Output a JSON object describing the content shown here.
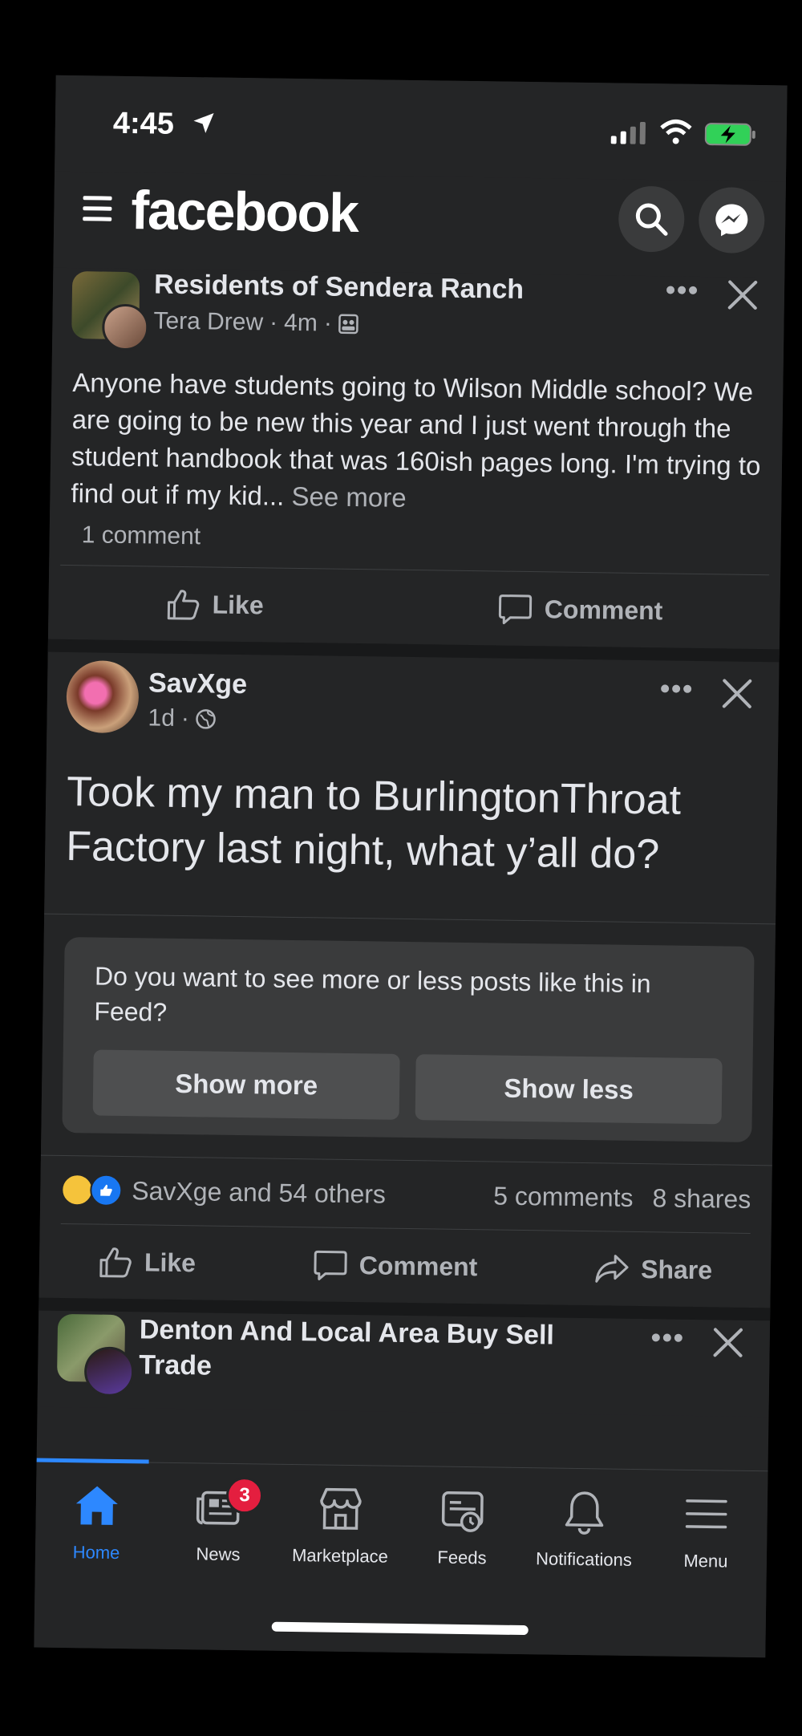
{
  "status": {
    "time": "4:45"
  },
  "app": {
    "logo": "facebook"
  },
  "posts": [
    {
      "group": "Residents of Sendera Ranch",
      "author": "Tera Drew",
      "time": "4m",
      "text": "Anyone have students going to Wilson Middle school? We are going to be new this year and I just went through the student handbook that was 160ish pages long. I'm trying to find out if my kid...",
      "see_more": "See more",
      "comment_count": "1 comment",
      "actions": {
        "like": "Like",
        "comment": "Comment"
      }
    },
    {
      "author": "SavXge",
      "time": "1d",
      "text": "Took my man to BurlingtonThroat Factory last night, what y’all do?",
      "feedback": {
        "question": "Do you want to see more or less posts like this in Feed?",
        "show_more": "Show more",
        "show_less": "Show less"
      },
      "reactions_text": "SavXge and 54 others",
      "comments": "5 comments",
      "shares": "8 shares",
      "actions": {
        "like": "Like",
        "comment": "Comment",
        "share": "Share"
      }
    },
    {
      "group": "Denton And Local Area Buy Sell Trade"
    }
  ],
  "tabs": [
    {
      "label": "Home",
      "icon": "home-icon",
      "active": true
    },
    {
      "label": "News",
      "icon": "news-icon",
      "badge": "3"
    },
    {
      "label": "Marketplace",
      "icon": "marketplace-icon"
    },
    {
      "label": "Feeds",
      "icon": "feeds-icon"
    },
    {
      "label": "Notifications",
      "icon": "bell-icon"
    },
    {
      "label": "Menu",
      "icon": "menu-icon"
    }
  ],
  "colors": {
    "accent": "#2d88ff",
    "background": "#242526",
    "badge": "#e41e3f"
  }
}
